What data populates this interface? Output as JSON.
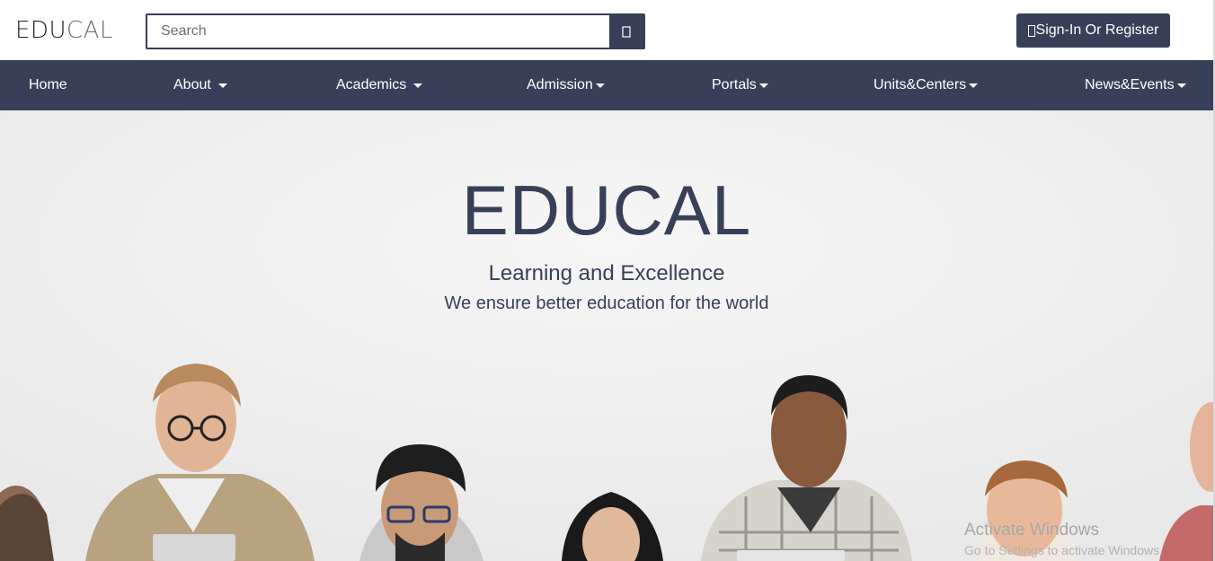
{
  "header": {
    "logo_part1": "EDU",
    "logo_part2": "CAL",
    "search_placeholder": "Search",
    "search_icon": "search-icon",
    "signin_label": "Sign-In Or Register",
    "signin_icon": "user-icon"
  },
  "nav": {
    "items": [
      {
        "label": "Home"
      },
      {
        "label": "About"
      },
      {
        "label": "Academics"
      },
      {
        "label": "Admission"
      },
      {
        "label": "Portals"
      },
      {
        "label": "Units&Centers"
      },
      {
        "label": "News&Events"
      }
    ]
  },
  "hero": {
    "title": "EDUCAL",
    "subtitle": "Learning and Excellence",
    "tagline": "We ensure better education for the world"
  },
  "overlay": {
    "activate_title": "Activate Windows",
    "activate_sub": "Go to Settings to activate Windows."
  },
  "colors": {
    "primary": "#374058",
    "background": "#ffffff",
    "hero_bg": "#f2f2f2"
  }
}
